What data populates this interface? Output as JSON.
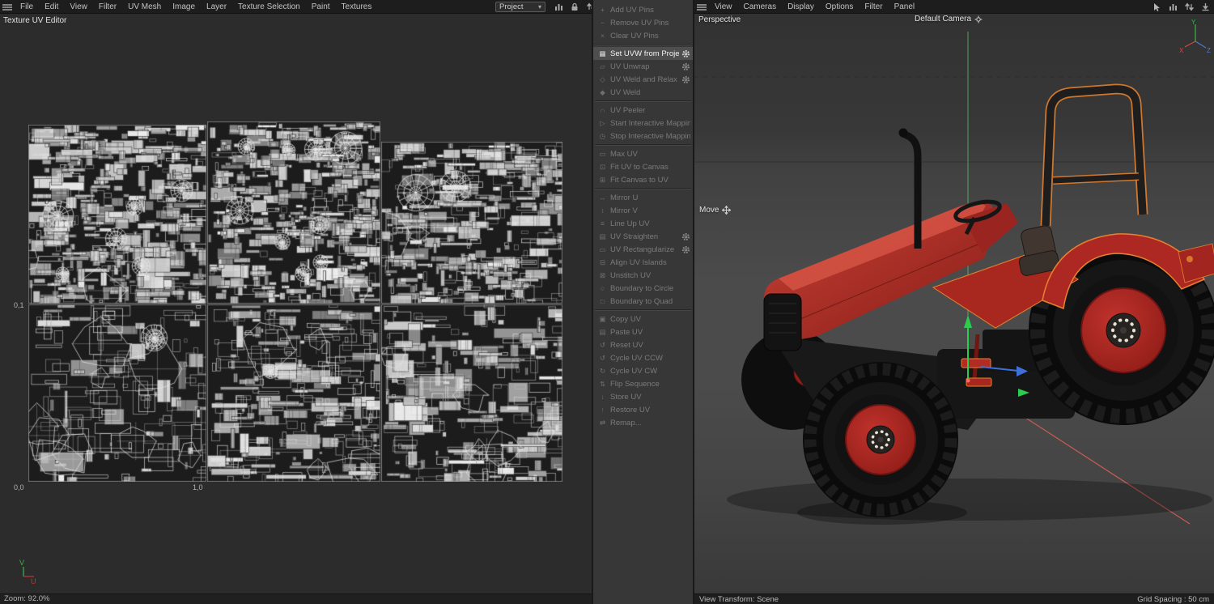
{
  "menus": {
    "left": {
      "items": [
        "File",
        "Edit",
        "View",
        "Filter",
        "UV Mesh",
        "Image",
        "Layer",
        "Texture Selection",
        "Paint",
        "Textures"
      ]
    },
    "right": {
      "items": [
        "View",
        "Cameras",
        "Display",
        "Options",
        "Filter",
        "Panel"
      ]
    }
  },
  "toolbar": {
    "project_label": "Project"
  },
  "uv_editor": {
    "title": "Texture UV Editor",
    "axis_labels": {
      "mid_left": "0,1",
      "bottom_left": "0,0",
      "bottom_right": "1,0"
    },
    "axis_indicator": {
      "u": "U",
      "v": "V"
    },
    "status_zoom": "Zoom: 92.0%"
  },
  "command_panel": {
    "groups": [
      {
        "items": [
          {
            "label": "Add UV Pins",
            "icon": "+",
            "disabled": true
          },
          {
            "label": "Remove UV Pins",
            "icon": "−",
            "disabled": true
          },
          {
            "label": "Clear UV Pins",
            "icon": "×",
            "disabled": true
          }
        ]
      },
      {
        "items": [
          {
            "label": "Set UVW from Projection",
            "icon": "▦",
            "active": true,
            "gear": true
          },
          {
            "label": "UV Unwrap",
            "icon": "▱",
            "disabled": true,
            "gear": true
          },
          {
            "label": "UV Weld and Relax",
            "icon": "◇",
            "disabled": true,
            "gear": true
          },
          {
            "label": "UV Weld",
            "icon": "◆",
            "disabled": true
          }
        ]
      },
      {
        "items": [
          {
            "label": "UV Peeler",
            "icon": "∩",
            "disabled": true
          },
          {
            "label": "Start Interactive Mapping",
            "icon": "▷",
            "disabled": true
          },
          {
            "label": "Stop Interactive Mapping",
            "icon": "◷",
            "disabled": true
          }
        ]
      },
      {
        "items": [
          {
            "label": "Max UV",
            "icon": "▭",
            "disabled": true
          },
          {
            "label": "Fit UV to Canvas",
            "icon": "⊡",
            "disabled": true
          },
          {
            "label": "Fit Canvas to UV",
            "icon": "⊞",
            "disabled": true
          }
        ]
      },
      {
        "items": [
          {
            "label": "Mirror U",
            "icon": "↔",
            "disabled": true
          },
          {
            "label": "Mirror V",
            "icon": "↕",
            "disabled": true
          },
          {
            "label": "Line Up UV",
            "icon": "≡",
            "disabled": true
          },
          {
            "label": "UV Straighten",
            "icon": "▤",
            "disabled": true,
            "gear": true
          },
          {
            "label": "UV Rectangularize",
            "icon": "▭",
            "disabled": true,
            "gear": true
          },
          {
            "label": "Align UV Islands",
            "icon": "⊟",
            "disabled": true
          },
          {
            "label": "Unstitch UV",
            "icon": "⊠",
            "disabled": true
          },
          {
            "label": "Boundary to Circle",
            "icon": "○",
            "disabled": true
          },
          {
            "label": "Boundary to Quad",
            "icon": "□",
            "disabled": true
          }
        ]
      },
      {
        "items": [
          {
            "label": "Copy UV",
            "icon": "▣",
            "disabled": true
          },
          {
            "label": "Paste UV",
            "icon": "▤",
            "disabled": true
          },
          {
            "label": "Reset UV",
            "icon": "↺",
            "disabled": true
          },
          {
            "label": "Cycle UV CCW",
            "icon": "↺",
            "disabled": true
          },
          {
            "label": "Cycle UV CW",
            "icon": "↻",
            "disabled": true
          },
          {
            "label": "Flip Sequence",
            "icon": "⇅",
            "disabled": true
          },
          {
            "label": "Store UV",
            "icon": "↓",
            "disabled": true
          },
          {
            "label": "Restore UV",
            "icon": "↑",
            "disabled": true
          },
          {
            "label": "Remap...",
            "icon": "⇄",
            "disabled": true
          }
        ]
      }
    ]
  },
  "viewport": {
    "view_label": "Perspective",
    "camera_label": "Default Camera",
    "tool_label": "Move",
    "status_left": "View Transform: Scene",
    "status_right": "Grid Spacing : 50 cm",
    "axis_triad": {
      "x": "X",
      "y": "Y",
      "z": "Z"
    }
  },
  "colors": {
    "selection_orange": "#e8822e",
    "tractor_red": "#ad2822",
    "axis_green": "#2ecc4e",
    "axis_red": "#d85248",
    "axis_blue": "#3f6fd8"
  }
}
